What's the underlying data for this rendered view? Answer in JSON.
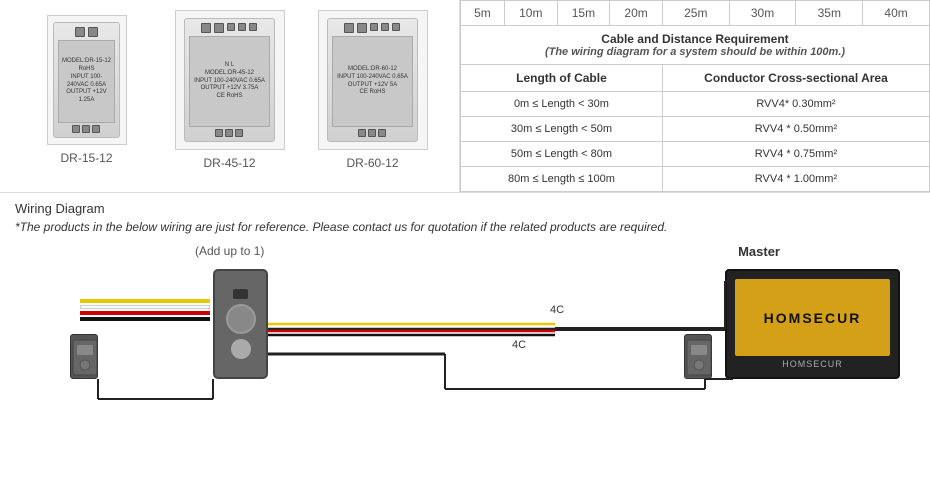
{
  "distances": {
    "label": "Length of Cable",
    "values": [
      "5m",
      "10m",
      "15m",
      "20m",
      "25m",
      "30m",
      "35m",
      "40m"
    ]
  },
  "table": {
    "title": "Cable and Distance Requirement",
    "subtitle": "(The wiring diagram for a system should be within 100m.)",
    "col1": "Length of Cable",
    "col2": "Conductor Cross-sectional Area",
    "rows": [
      {
        "length": "0m ≤ Length < 30m",
        "area": "RVV4* 0.30mm²"
      },
      {
        "length": "30m ≤ Length < 50m",
        "area": "RVV4 * 0.50mm²"
      },
      {
        "length": "50m ≤ Length < 80m",
        "area": "RVV4 * 0.75mm²"
      },
      {
        "length": "80m ≤ Length ≤ 100m",
        "area": "RVV4 * 1.00mm²"
      }
    ]
  },
  "power_supplies": [
    {
      "id": "ps1",
      "model": "DR-15-12"
    },
    {
      "id": "ps2",
      "model": "DR-45-12"
    },
    {
      "id": "ps3",
      "model": "DR-60-12"
    }
  ],
  "wiring": {
    "title": "Wiring Diagram",
    "note": "*The products in the below wiring are just for reference. Please contact us for quotation if the related products are required.",
    "add_up_label": "(Add up to 1)",
    "master_label": "Master",
    "cable_label_1": "4C",
    "cable_label_2": "4C",
    "monitor_brand": "HOMSECUR",
    "monitor_sub": "HOMSECUR"
  },
  "colors": {
    "wire_yellow": "#e8c800",
    "wire_white": "#ffffff",
    "wire_red": "#cc0000",
    "wire_black": "#111111",
    "monitor_bg": "#d4a017"
  }
}
